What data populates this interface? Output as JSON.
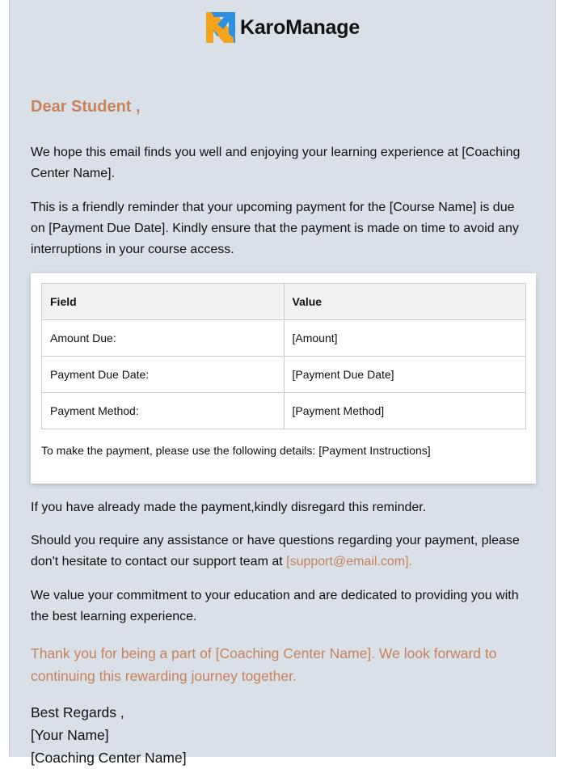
{
  "brand": {
    "name": "KaroManage",
    "colors": {
      "orange": "#f7a21b",
      "blue": "#2d8fe0",
      "accent": "#c8805a",
      "background": "#dae0e8"
    }
  },
  "greeting": "Dear Student ,",
  "paragraphs": {
    "p1": "We hope this email finds you well and enjoying your learning experience at [Coaching Center Name].",
    "p2": "This is a friendly reminder that your upcoming payment for the [Course Name] is due on [Payment Due Date]. Kindly ensure that the payment is made on time to avoid any interruptions in your course access.",
    "p3": "If you have already made the payment,kindly disregard this reminder.",
    "p4": "Should you require any assistance or have questions regarding your payment, please don't hesitate to contact our support team at ",
    "p4_link": "[support@email.com].",
    "p5": "We value your commitment to your education and are dedicated to providing you with the best learning experience.",
    "thanks": "Thank you for being a part of [Coaching Center Name]. We look forward to continuing this rewarding journey together."
  },
  "table": {
    "headers": [
      "Field",
      "Value"
    ],
    "rows": [
      [
        "Amount Due:",
        "[Amount]"
      ],
      [
        "Payment Due Date:",
        "[Payment Due Date]"
      ],
      [
        "Payment Method:",
        "[Payment Method]"
      ]
    ]
  },
  "instructions": "To make the payment, please use the following details: [Payment Instructions]",
  "signature": {
    "closing": "Best Regards ,",
    "name": "[Your Name]",
    "org": "[Coaching Center Name]"
  }
}
